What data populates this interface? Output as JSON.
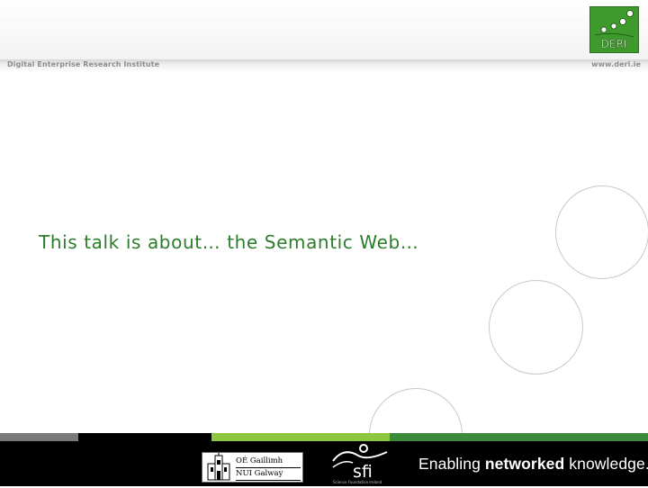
{
  "header": {
    "institute": "Digital Enterprise Research Institute",
    "website": "www.deri.ie",
    "logo_text": "DERI"
  },
  "slide": {
    "text": "This talk is about… the Semantic Web…"
  },
  "footer": {
    "nuig_line1": "OÉ Gaillimh",
    "nuig_line2": "NUI Galway",
    "sfi_text": "sfi",
    "sfi_subtext": "Science Foundation Ireland",
    "tagline_part1": "Enabling ",
    "tagline_bold": "networked",
    "tagline_part2": " knowledge."
  },
  "colors": {
    "accent_green": "#2b7d2b",
    "logo_green": "#3f9a2e",
    "stripe_gray": "#7a7a7a",
    "stripe_lime": "#8dc63f",
    "stripe_green": "#3c8a3c"
  }
}
